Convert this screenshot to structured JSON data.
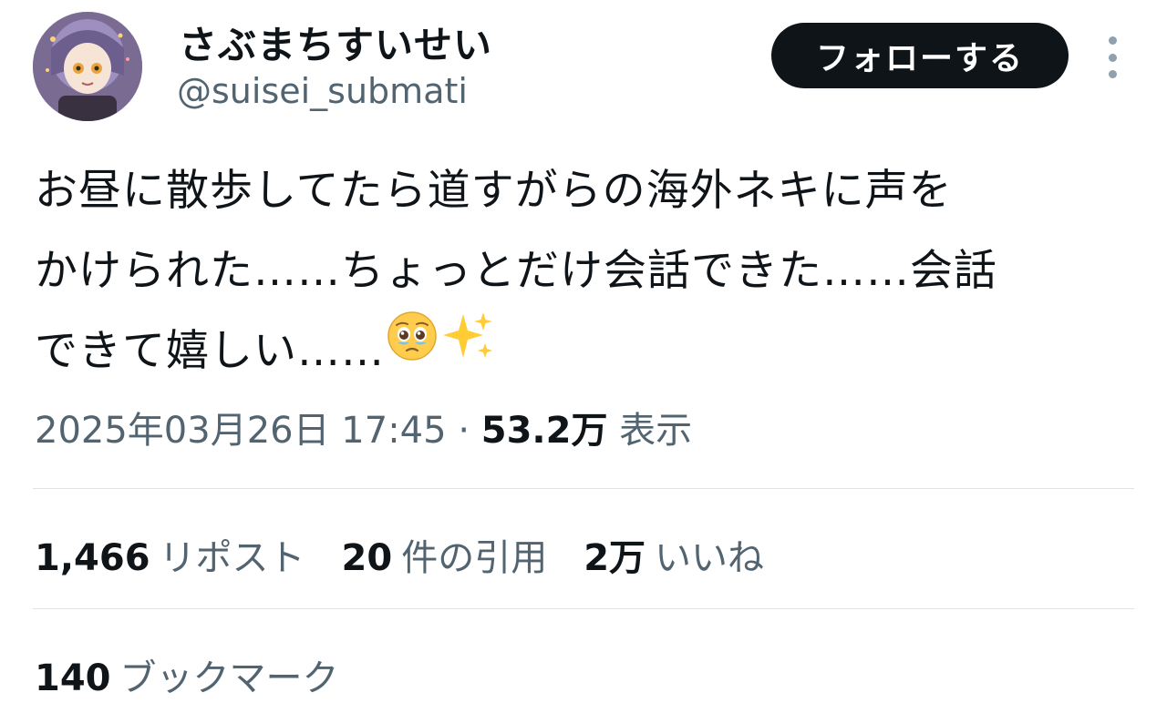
{
  "user": {
    "display_name": "さぶまちすいせい",
    "handle": "@suisei_submati"
  },
  "follow_button_label": "フォローする",
  "tweet": {
    "lines": [
      "お昼に散歩してたら道すがらの海外ネキに声を",
      "かけられた……ちょっとだけ会話できた……会話",
      "できて嬉しい……"
    ],
    "emojis": [
      "pleading-face-emoji",
      "sparkles-emoji"
    ]
  },
  "meta": {
    "timestamp": "2025年03月26日 17:45",
    "separator": "·",
    "views_count": "53.2万",
    "views_label": "表示"
  },
  "stats": {
    "reposts": {
      "num": "1,466",
      "label": "リポスト"
    },
    "quotes": {
      "num": "20",
      "label": "件の引用"
    },
    "likes": {
      "num": "2万",
      "label": "いいね"
    },
    "bookmarks": {
      "num": "140",
      "label": "ブックマーク"
    }
  },
  "colors": {
    "text_primary": "#0f1419",
    "text_secondary": "#536471",
    "divider": "#dfe3e6",
    "follow_bg": "#0f1419",
    "follow_text": "#ffffff"
  }
}
